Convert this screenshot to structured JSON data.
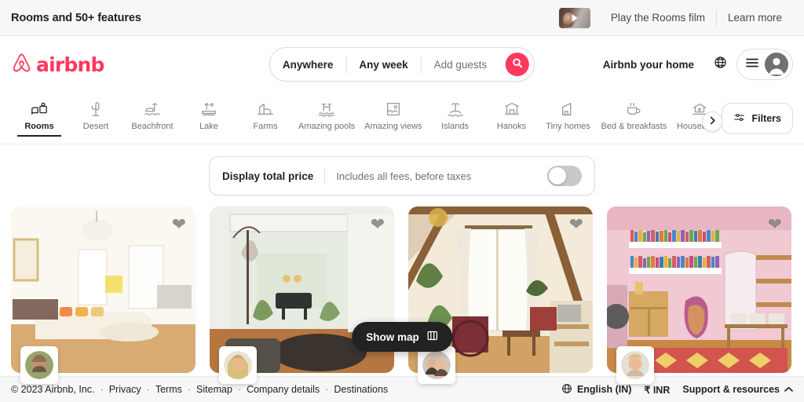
{
  "announcement": {
    "title": "Rooms and 50+ features",
    "film_link": "Play the Rooms film",
    "learn_more": "Learn more",
    "thumb_icon": "play-icon"
  },
  "header": {
    "brand": "airbnb",
    "logo_icon": "airbnb-logo-icon",
    "search": {
      "where": "Anywhere",
      "when": "Any week",
      "guests": "Add guests",
      "search_icon": "search-icon"
    },
    "host_link": "Airbnb your home",
    "globe_icon": "globe-icon",
    "menu_icon": "hamburger-menu-icon",
    "avatar_icon": "user-avatar-icon"
  },
  "categories": {
    "items": [
      {
        "label": "Rooms",
        "icon": "rooms-icon",
        "active": true
      },
      {
        "label": "Desert",
        "icon": "cactus-icon",
        "active": false
      },
      {
        "label": "Beachfront",
        "icon": "beachfront-icon",
        "active": false
      },
      {
        "label": "Lake",
        "icon": "lake-icon",
        "active": false
      },
      {
        "label": "Farms",
        "icon": "farm-icon",
        "active": false
      },
      {
        "label": "Amazing pools",
        "icon": "pool-icon",
        "active": false
      },
      {
        "label": "Amazing views",
        "icon": "views-icon",
        "active": false
      },
      {
        "label": "Islands",
        "icon": "island-icon",
        "active": false
      },
      {
        "label": "Hanoks",
        "icon": "hanok-icon",
        "active": false
      },
      {
        "label": "Tiny homes",
        "icon": "tiny-home-icon",
        "active": false
      },
      {
        "label": "Bed & breakfasts",
        "icon": "coffee-cup-icon",
        "active": false
      },
      {
        "label": "Houseboats",
        "icon": "houseboat-icon",
        "active": false
      }
    ],
    "next_icon": "chevron-right-icon",
    "filters": {
      "label": "Filters",
      "icon": "filters-sliders-icon"
    }
  },
  "total_price_bar": {
    "title": "Display total price",
    "subtitle": "Includes all fees, before taxes",
    "toggle_state": "off"
  },
  "listings": [
    {
      "photo_alt": "Bright cream living room with chandelier",
      "heart_icon": "heart-icon",
      "host_avatar": "host-avatar-icon",
      "style": "img-a"
    },
    {
      "photo_alt": "Courtyard garden seen through open glass doors",
      "heart_icon": "heart-icon",
      "host_avatar": "host-avatar-icon",
      "style": "img-b"
    },
    {
      "photo_alt": "Timber-beamed loft living room with chandelier",
      "heart_icon": "heart-icon",
      "host_avatar": "host-avatar-icon",
      "style": "img-c"
    },
    {
      "photo_alt": "Pink room with bookshelves and patterned rug",
      "heart_icon": "heart-icon",
      "host_avatar": "host-avatar-icon",
      "style": "img-d"
    }
  ],
  "show_map": {
    "label": "Show map",
    "icon": "map-icon"
  },
  "footer": {
    "copyright": "© 2023 Airbnb, Inc.",
    "links": [
      "Privacy",
      "Terms",
      "Sitemap",
      "Company details",
      "Destinations"
    ],
    "language": "English (IN)",
    "language_icon": "globe-icon",
    "currency": "₹ INR",
    "support": "Support & resources",
    "support_icon": "chevron-up-icon"
  },
  "colors": {
    "brand": "#FF385C",
    "text": "#222222",
    "muted": "#717171",
    "border": "#DDDDDD",
    "bg_subtle": "#F7F7F7",
    "dark_pill": "#222222"
  }
}
